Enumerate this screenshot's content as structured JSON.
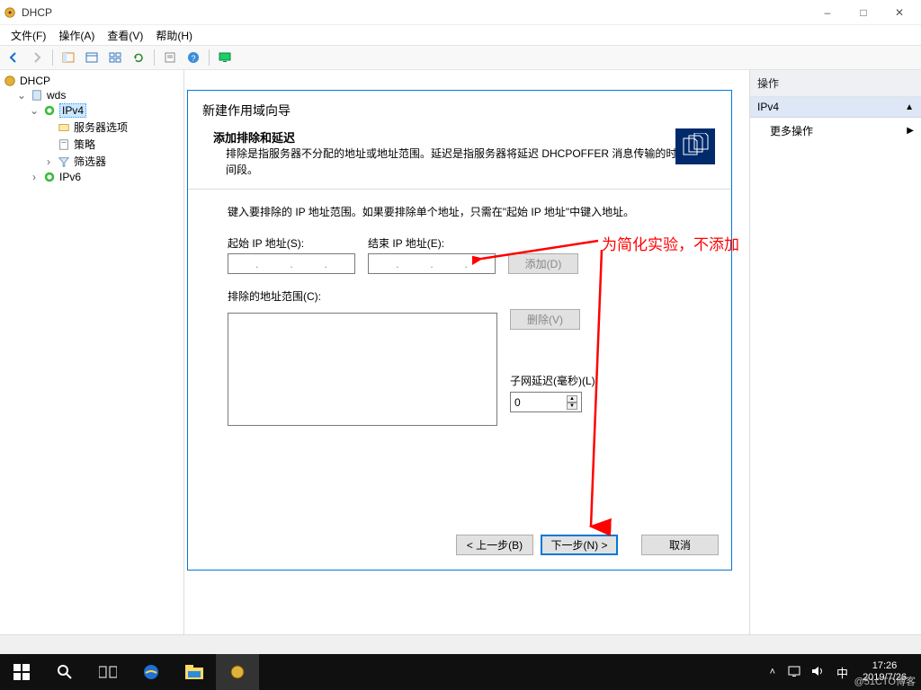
{
  "window": {
    "title": "DHCP"
  },
  "menu": {
    "file": "文件(F)",
    "action": "操作(A)",
    "view": "查看(V)",
    "help": "帮助(H)"
  },
  "tree": {
    "root": "DHCP",
    "server": "wds",
    "ipv4": "IPv4",
    "ipv4_children": {
      "server_options": "服务器选项",
      "policies": "策略",
      "filters": "筛选器"
    },
    "ipv6": "IPv6"
  },
  "actions": {
    "header": "操作",
    "group": "IPv4",
    "more": "更多操作"
  },
  "wizard": {
    "wizard_title": "新建作用域向导",
    "section_title": "添加排除和延迟",
    "section_desc": "排除是指服务器不分配的地址或地址范围。延迟是指服务器将延迟 DHCPOFFER 消息传输的时间段。",
    "instruction": "键入要排除的 IP 地址范围。如果要排除单个地址，只需在\"起始 IP 地址\"中键入地址。",
    "start_ip_label": "起始 IP 地址(S):",
    "end_ip_label": "结束 IP 地址(E):",
    "add_btn": "添加(D)",
    "excluded_label": "排除的地址范围(C):",
    "remove_btn": "删除(V)",
    "delay_label": "子网延迟(毫秒)(L):",
    "delay_value": "0",
    "back_btn": "< 上一步(B)",
    "next_btn": "下一步(N) >",
    "cancel_btn": "取消"
  },
  "annotation": {
    "text": "为简化实验，不添加"
  },
  "taskbar": {
    "time": "17:26",
    "date": "2019/7/26",
    "ime": "中",
    "watermark": "@51CTO博客"
  }
}
